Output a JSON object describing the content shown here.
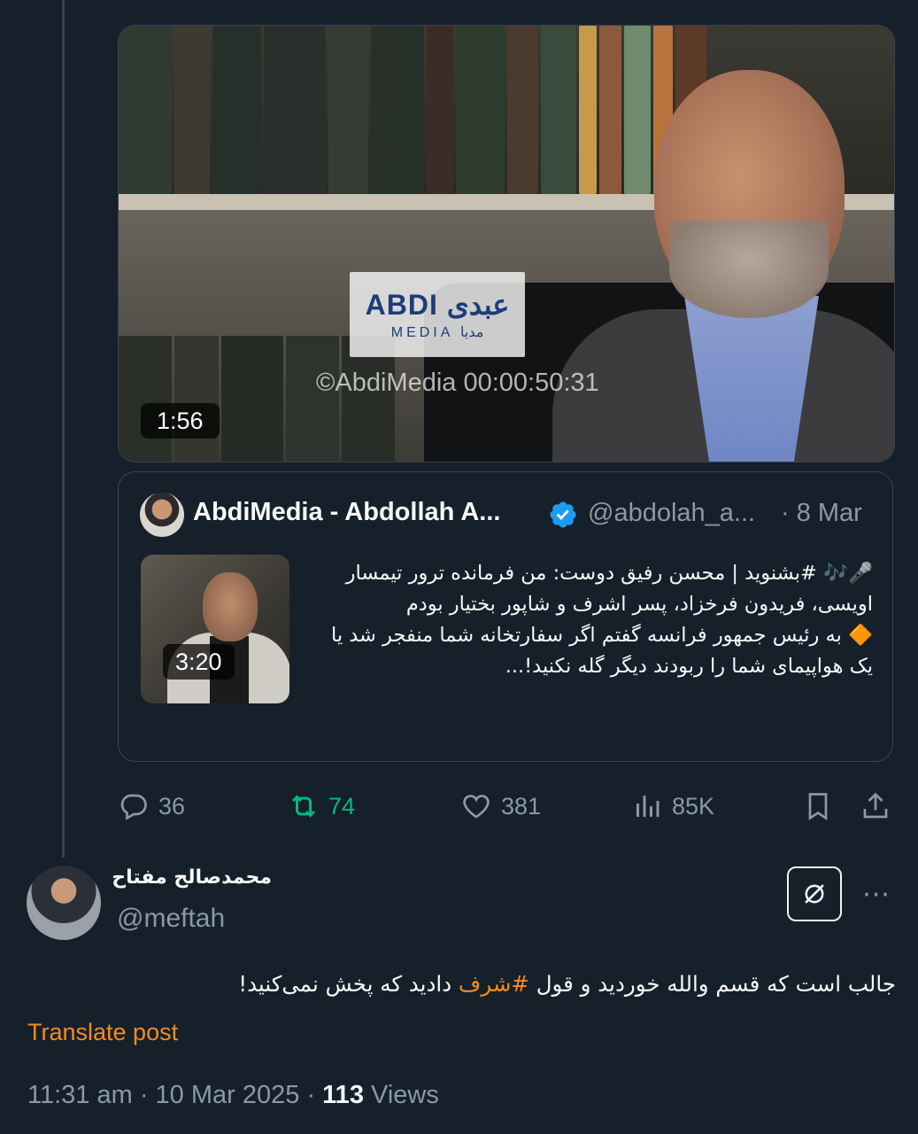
{
  "video": {
    "watermark_top": "ABDI عبدی",
    "watermark_bottom": "MEDIA مدیا",
    "timecode": "©AbdiMedia 00:00:50:31",
    "duration": "1:56"
  },
  "quote": {
    "author_name": "AbdiMedia - Abdollah A...",
    "handle": "@abdolah_a...",
    "date": "· 8 Mar",
    "thumb_duration": "3:20",
    "text_line1": "🎤🎶 #بشنوید | محسن رفیق دوست: من فرمانده ترور تیمسار اویسی، فریدون فرخزاد، پسر اشرف و شاپور بختیار بودم",
    "text_line2": "🔶 به رئیس جمهور فرانسه گفتم اگر سفارتخانه شما منفجر شد یا یک هواپیمای شما را ربودند دیگر گله نکنید!...",
    "verified_color": "#1d9bf0"
  },
  "actions": {
    "replies": "36",
    "reposts": "74",
    "likes": "381",
    "views": "85K",
    "icons": [
      "reply-icon",
      "repost-icon",
      "like-icon",
      "views-icon",
      "bookmark-icon",
      "share-icon"
    ]
  },
  "reply": {
    "name": "محمدصالح مفتاح",
    "handle": "@meftah",
    "text_before": "جالب است که قسم والله خوردید و قول",
    "hashtag": "#شرف",
    "text_after": "دادید که پخش نمی‌کنید!",
    "translate_label": "Translate post",
    "time": "11:31 am",
    "date": "10 Mar 2025",
    "views_count": "113",
    "views_label": "Views",
    "accent_color": "#f58b1e"
  }
}
